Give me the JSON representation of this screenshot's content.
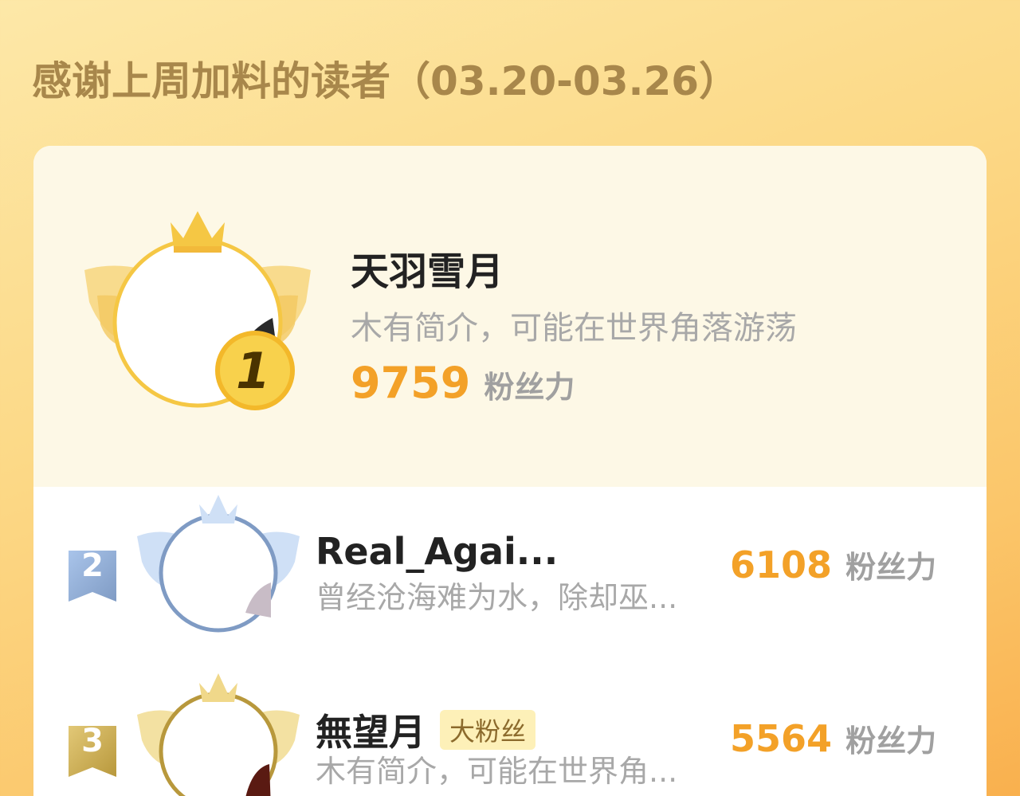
{
  "title": "感谢上周加料的读者（03.20-03.26）",
  "colors": {
    "accent": "#f3a128",
    "title": "#a8874b",
    "gold": "#f5c744",
    "silver": "#7f9bc4",
    "bronze": "#b8983c"
  },
  "ranking": [
    {
      "rank": "1",
      "name": "天羽雪月",
      "bio": "木有简介，可能在世界角落游荡",
      "score": "9759",
      "unit": "粉丝力",
      "badge_icon": "gold-crown-wings-icon"
    },
    {
      "rank": "2",
      "name": "Real_Agai...",
      "bio": "曾经沧海难为水，除却巫...",
      "score": "6108",
      "unit": "粉丝力",
      "badge_icon": "silver-crown-wings-icon"
    },
    {
      "rank": "3",
      "name": "無望月",
      "tag": "大粉丝",
      "bio": "木有简介，可能在世界角...",
      "score": "5564",
      "unit": "粉丝力",
      "badge_icon": "bronze-crown-wings-icon"
    }
  ]
}
